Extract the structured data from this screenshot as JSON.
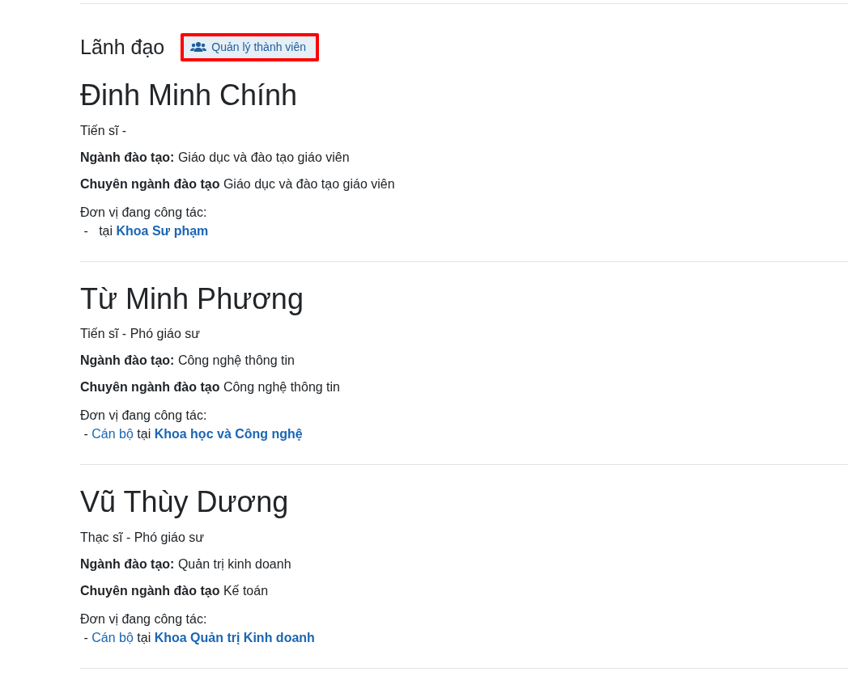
{
  "section": {
    "title": "Lãnh đạo",
    "manage_button": {
      "label": "Quản lý thành viên",
      "highlighted": true
    }
  },
  "members": [
    {
      "name": "Đinh Minh Chính",
      "degree": "Tiến sĩ -",
      "major": "**Ngành đào tạo:** Giáo dục và đào tạo giáo viên",
      "specialty": "**Chuyên ngành đào tạo** Giáo dục và đào tạo giáo viên",
      "workplace_label": "Đơn vị đang công tác:",
      "workplace": {
        "prefix": "-",
        "connector": "tại",
        "unit": "Khoa Sư phạm"
      }
    },
    {
      "name": "Từ Minh Phương",
      "degree": "Tiến sĩ - Phó giáo sư",
      "major": "**Ngành đào tạo:** Công nghệ thông tin",
      "specialty": "**Chuyên ngành đào tạo** Công nghệ thông tin",
      "workplace_label": "Đơn vị đang công tác:",
      "workplace": {
        "prefix": "-",
        "role": "Cán bộ",
        "connector": "tại",
        "unit": "Khoa học và Công nghệ"
      }
    },
    {
      "name": "Vũ Thùy Dương",
      "degree": "Thạc sĩ - Phó giáo sư",
      "major": "**Ngành đào tạo:** Quản trị kinh doanh",
      "specialty": "**Chuyên ngành đào tạo** Kế toán",
      "workplace_label": "Đơn vị đang công tác:",
      "workplace": {
        "prefix": "-",
        "role": "Cán bộ",
        "connector": "tại",
        "unit": "Khoa Quản trị Kinh doanh"
      }
    }
  ]
}
